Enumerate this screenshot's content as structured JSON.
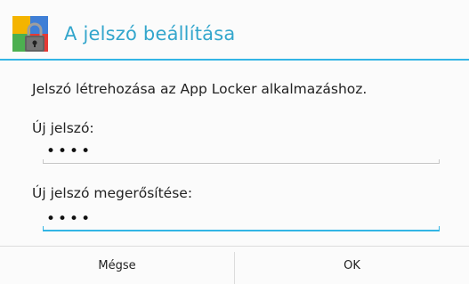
{
  "dialog": {
    "title": "A jelszó beállítása",
    "icon": "lock-icon",
    "accent_color": "#33b5e5",
    "message": "Jelszó létrehozása az App Locker alkalmazáshoz.",
    "fields": [
      {
        "label": "Új jelszó:",
        "value": "••••"
      },
      {
        "label": "Új jelszó megerősítése:",
        "value": "••••"
      }
    ],
    "buttons": {
      "cancel": "Mégse",
      "ok": "OK"
    }
  }
}
